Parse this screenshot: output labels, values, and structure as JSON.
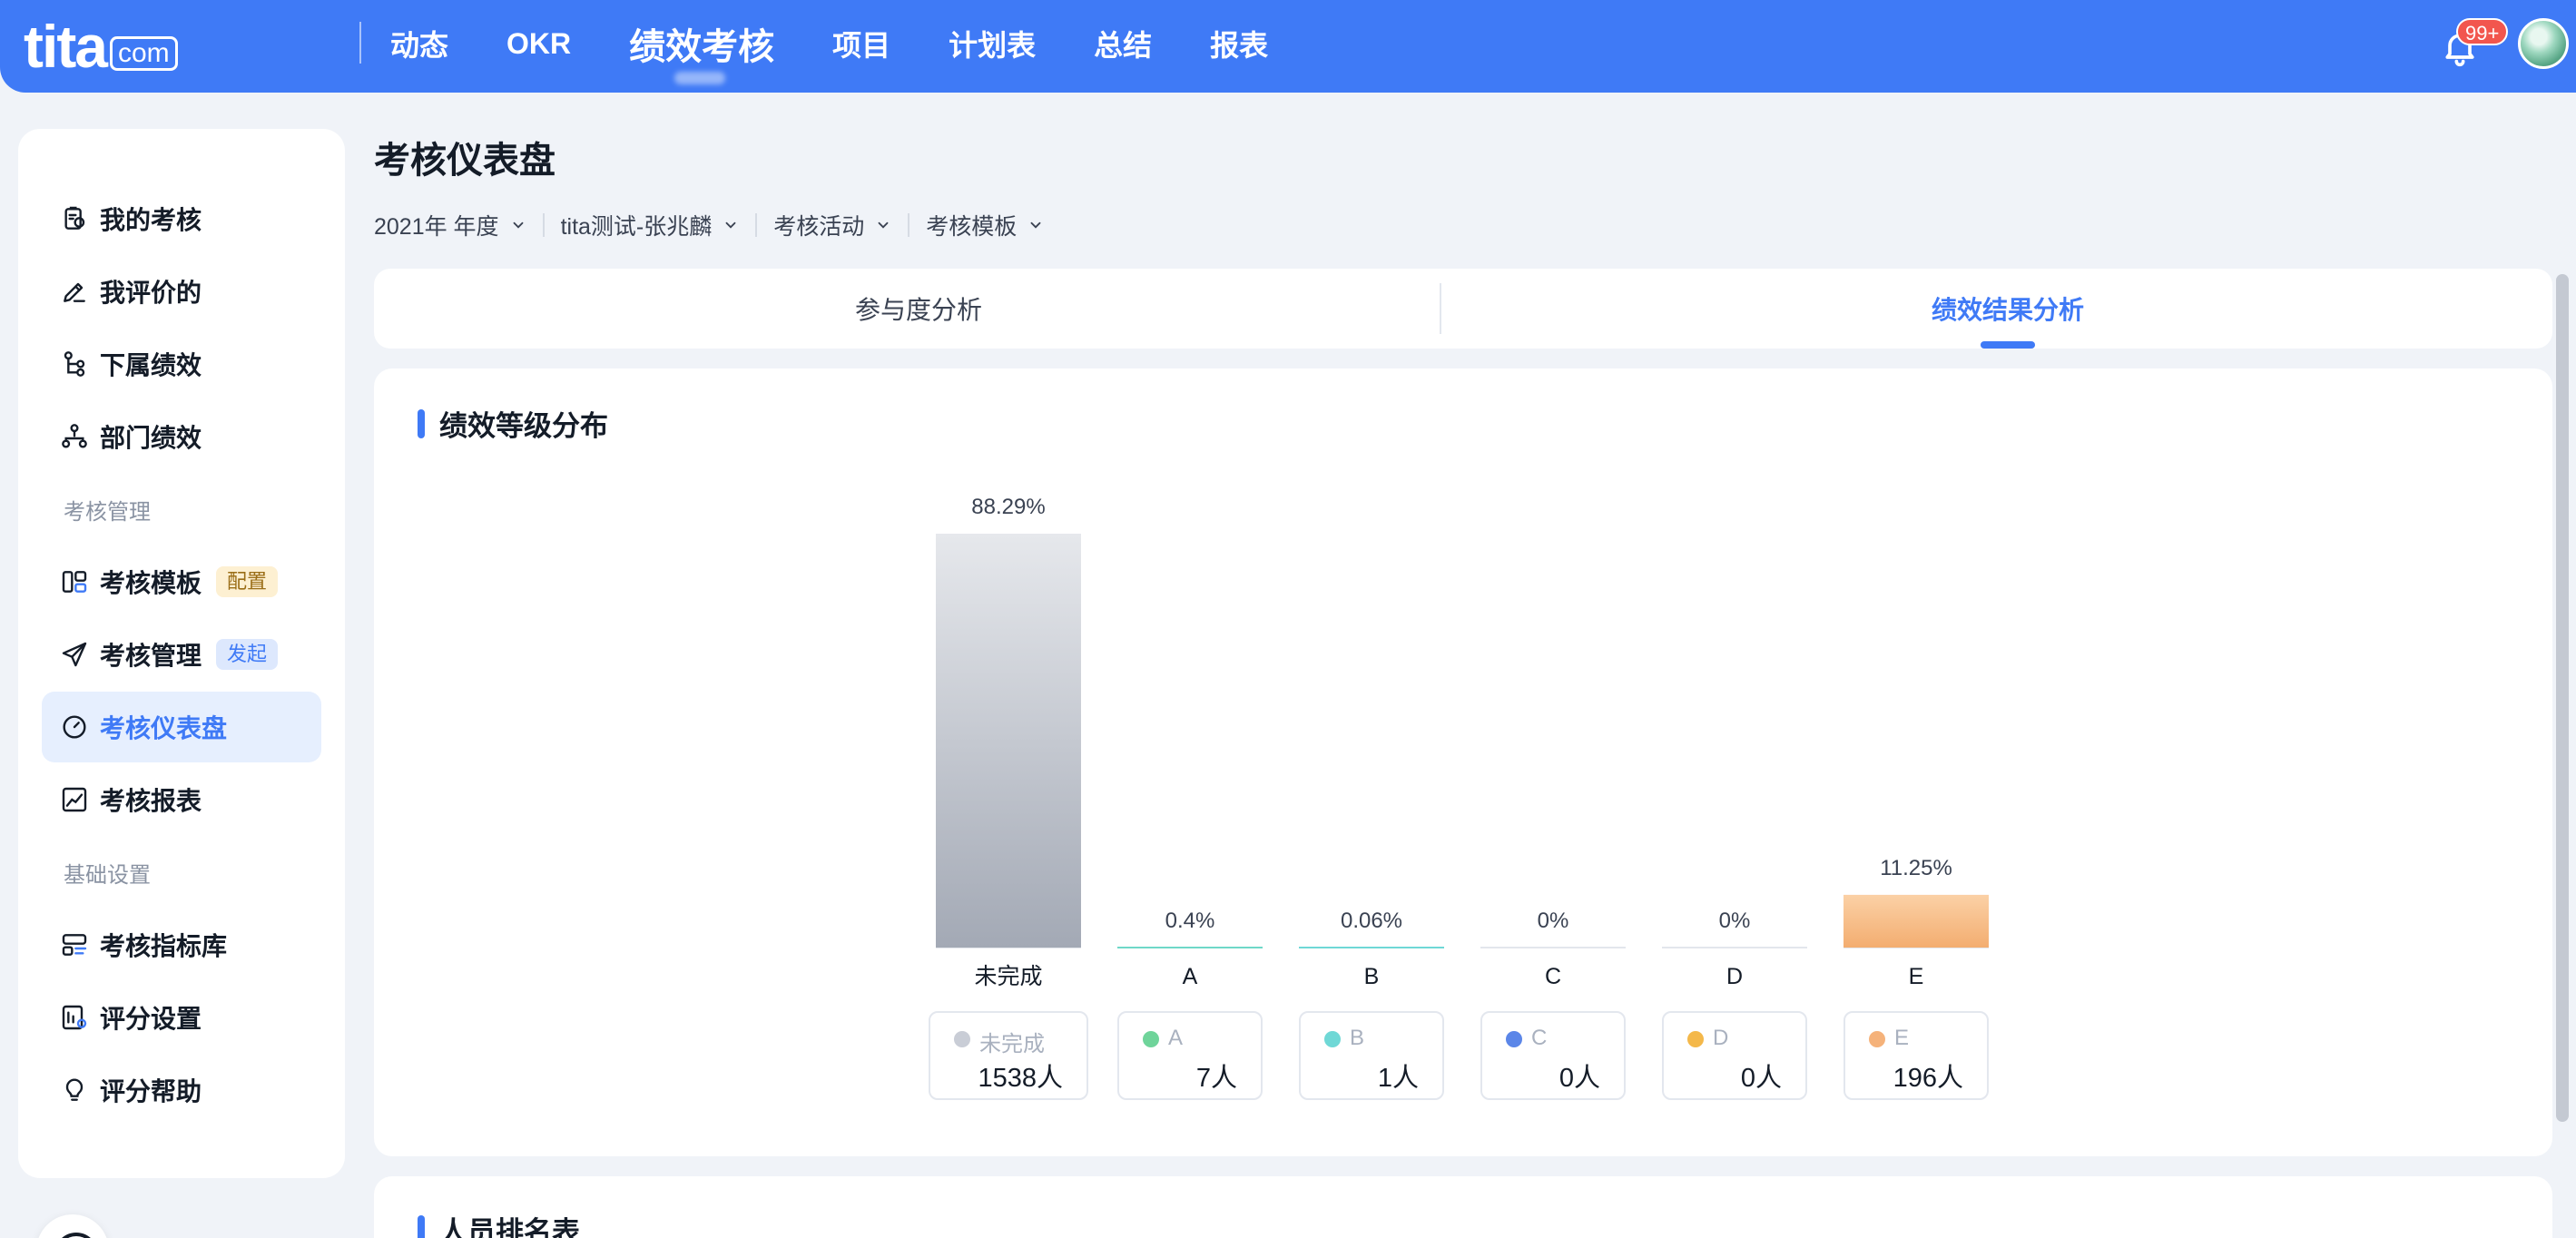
{
  "app": {
    "logo_main": "tita",
    "logo_suffix": "com",
    "notification_badge": "99+"
  },
  "nav": {
    "items": [
      {
        "label": "动态",
        "active": false
      },
      {
        "label": "OKR",
        "active": false
      },
      {
        "label": "绩效考核",
        "active": true
      },
      {
        "label": "项目",
        "active": false
      },
      {
        "label": "计划表",
        "active": false
      },
      {
        "label": "总结",
        "active": false
      },
      {
        "label": "报表",
        "active": false
      }
    ]
  },
  "sidebar": {
    "items": [
      {
        "label": "我的考核",
        "icon": "assessment-icon"
      },
      {
        "label": "我评价的",
        "icon": "pencil-icon"
      },
      {
        "label": "下属绩效",
        "icon": "hierarchy-icon"
      },
      {
        "label": "部门绩效",
        "icon": "org-chart-icon"
      },
      {
        "label": "考核模板",
        "icon": "template-icon",
        "tag": "配置"
      },
      {
        "label": "考核管理",
        "icon": "send-icon",
        "tag": "发起"
      },
      {
        "label": "考核仪表盘",
        "icon": "dashboard-icon",
        "active": true
      },
      {
        "label": "考核报表",
        "icon": "line-chart-icon"
      },
      {
        "label": "考核指标库",
        "icon": "indicator-list-icon"
      },
      {
        "label": "评分设置",
        "icon": "score-settings-icon"
      },
      {
        "label": "评分帮助",
        "icon": "lightbulb-icon"
      }
    ],
    "sections": [
      "考核管理",
      "基础设置"
    ]
  },
  "main": {
    "title": "考核仪表盘",
    "filters": [
      "2021年 年度",
      "tita测试-张兆麟",
      "考核活动",
      "考核模板"
    ],
    "tabs": [
      {
        "label": "参与度分析",
        "active": false
      },
      {
        "label": "绩效结果分析",
        "active": true
      }
    ],
    "section_title": "绩效等级分布",
    "section2_title": "人员排名表"
  },
  "colors": {
    "primary": "#3f7af6",
    "bar_incomplete_top": "#e6e8ec",
    "bar_incomplete_bottom": "#a3a9b5",
    "bar_e_top": "#fbd1a6",
    "bar_e_bottom": "#f3ad70"
  },
  "chart_data": {
    "type": "bar",
    "categories": [
      "未完成",
      "A",
      "B",
      "C",
      "D",
      "E"
    ],
    "values": [
      88.29,
      0.4,
      0.06,
      0,
      0,
      11.25
    ],
    "value_labels": [
      "88.29%",
      "0.4%",
      "0.06%",
      "0%",
      "0%",
      "11.25%"
    ],
    "counts": [
      "1538人",
      "7人",
      "1人",
      "0人",
      "0人",
      "196人"
    ],
    "legend_colors": [
      "#c9cdd6",
      "#6fd49a",
      "#6fd8d6",
      "#5b86e8",
      "#f4b84a",
      "#f5b27a"
    ],
    "bar_colors": [
      "#c3c7cf",
      "#6fd8c8",
      "#6fd8d6",
      "#e3e6ec",
      "#e3e6ec",
      "#f3b07a"
    ],
    "ylim": [
      0,
      88.29
    ],
    "grid": false
  }
}
